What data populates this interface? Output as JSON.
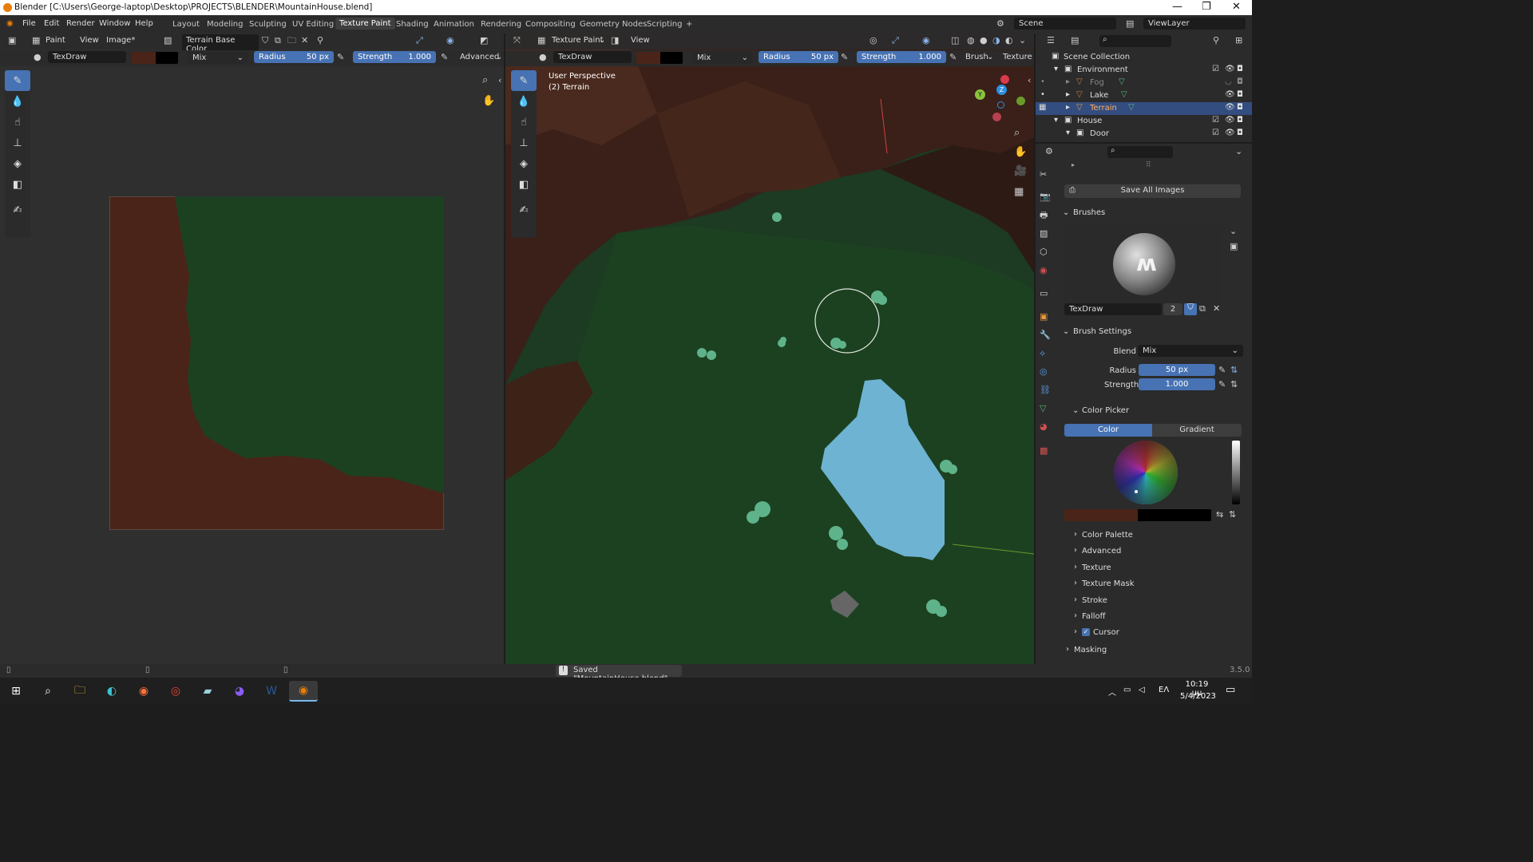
{
  "window": {
    "title": "Blender [C:\\Users\\George-laptop\\Desktop\\PROJECTS\\BLENDER\\MountainHouse.blend]"
  },
  "menu": {
    "file": "File",
    "edit": "Edit",
    "render": "Render",
    "window": "Window",
    "help": "Help"
  },
  "workspaces": [
    "Layout",
    "Modeling",
    "Sculpting",
    "UV Editing",
    "Texture Paint",
    "Shading",
    "Animation",
    "Rendering",
    "Compositing",
    "Geometry Nodes",
    "Scripting",
    "+"
  ],
  "scene": {
    "name": "Scene",
    "viewlayer": "ViewLayer"
  },
  "image_editor": {
    "mode": "Paint",
    "view": "View",
    "image_menu": "Image*",
    "image_name": "Terrain Base Color",
    "brush": "TexDraw",
    "blend": "Mix",
    "radius_label": "Radius",
    "radius_value": "50 px",
    "strength_label": "Strength",
    "strength_value": "1.000",
    "advanced": "Advanced"
  },
  "viewport": {
    "mode": "Texture Paint",
    "view": "View",
    "perspective": "User Perspective",
    "object": "(2) Terrain",
    "brush": "TexDraw",
    "blend": "Mix",
    "radius_label": "Radius",
    "radius_value": "50 px",
    "strength_label": "Strength",
    "strength_value": "1.000",
    "brush_menu": "Brush",
    "texture_menu": "Texture",
    "gizmo": {
      "x": "X",
      "y": "Y",
      "z": "Z"
    }
  },
  "outliner": {
    "items": [
      {
        "label": "Scene Collection"
      },
      {
        "label": "Environment"
      },
      {
        "label": "Fog"
      },
      {
        "label": "Lake"
      },
      {
        "label": "Terrain"
      },
      {
        "label": "House"
      },
      {
        "label": "Door"
      }
    ]
  },
  "properties": {
    "save_all": "Save All Images",
    "brushes_header": "Brushes",
    "brush_name": "TexDraw",
    "brush_users": "2",
    "brush_settings_header": "Brush Settings",
    "blend_label": "Blend",
    "blend_value": "Mix",
    "radius_label": "Radius",
    "radius_value": "50 px",
    "strength_label": "Strength",
    "strength_value": "1.000",
    "color_picker_header": "Color Picker",
    "tab_color": "Color",
    "tab_gradient": "Gradient",
    "sections": [
      "Color Palette",
      "Advanced",
      "Texture",
      "Texture Mask",
      "Stroke",
      "Falloff",
      "Cursor"
    ],
    "masking": "Masking"
  },
  "status": {
    "message": "Saved \"MountainHouse.blend\"",
    "version": "3.5.0"
  },
  "taskbar": {
    "lang": "ΕΛ",
    "time": "10:19 μμ",
    "date": "5/4/2023"
  },
  "colors": {
    "accent": "#4772b3",
    "brown": "#4a2418",
    "green": "#1c4121",
    "lake": "#6fb3d3"
  }
}
